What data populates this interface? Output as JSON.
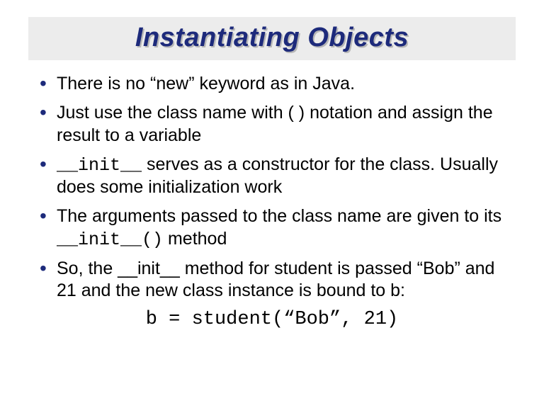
{
  "title": "Instantiating Objects",
  "bullets": {
    "b1_pre": "There is no ",
    "b1_q1": "“",
    "b1_kw": "new",
    "b1_q2": "”",
    "b1_post": " keyword as in Java.",
    "b2": "Just use the class name with ( ) notation and assign the result to a variable",
    "b3_code": "__init__",
    "b3_rest": " serves as a constructor for the class. Usually does some initialization work",
    "b4_pre": "The arguments passed to the class name are given to its  ",
    "b4_code": "__init__()",
    "b4_post": "  method",
    "b5_pre": "So, the __init__ method for student is passed ",
    "b5_q1": "“",
    "b5_bob": "Bob",
    "b5_q2": "”",
    "b5_post": " and 21 and the new class instance is bound to b:"
  },
  "code": {
    "lhs": "b = student(",
    "q1": "“",
    "arg1": "Bob",
    "q2": "”",
    "sep": ", 21",
    "rparen": ")"
  }
}
